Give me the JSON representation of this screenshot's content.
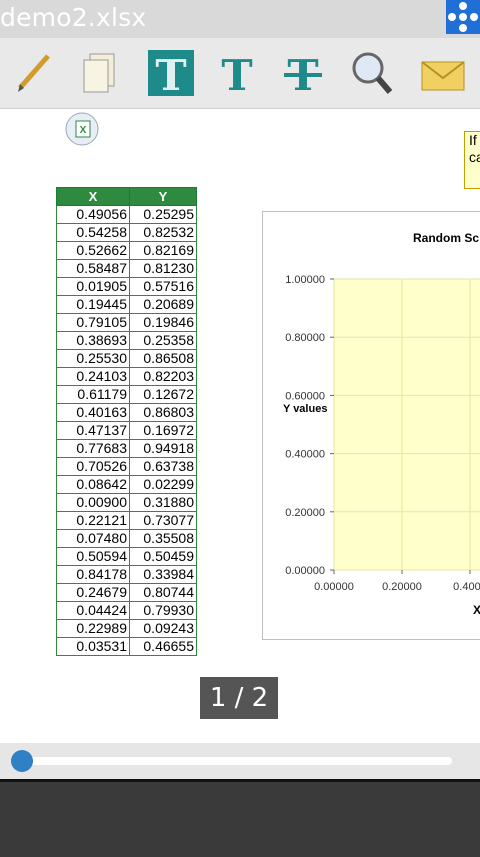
{
  "window": {
    "title": "demo2.xlsx"
  },
  "toolbar": {
    "buttons": [
      {
        "icon": "pencil-icon"
      },
      {
        "icon": "pages-icon"
      },
      {
        "icon": "text-bold-icon"
      },
      {
        "icon": "text-icon"
      },
      {
        "icon": "text-strikethrough-icon"
      },
      {
        "icon": "search-icon"
      },
      {
        "icon": "mail-icon"
      }
    ]
  },
  "sheet": {
    "columns": [
      "X",
      "Y"
    ],
    "rows": [
      [
        "0.49056",
        "0.25295"
      ],
      [
        "0.54258",
        "0.82532"
      ],
      [
        "0.52662",
        "0.82169"
      ],
      [
        "0.58487",
        "0.81230"
      ],
      [
        "0.01905",
        "0.57516"
      ],
      [
        "0.19445",
        "0.20689"
      ],
      [
        "0.79105",
        "0.19846"
      ],
      [
        "0.38693",
        "0.25358"
      ],
      [
        "0.25530",
        "0.86508"
      ],
      [
        "0.24103",
        "0.82203"
      ],
      [
        "0.61179",
        "0.12672"
      ],
      [
        "0.40163",
        "0.86803"
      ],
      [
        "0.47137",
        "0.16972"
      ],
      [
        "0.77683",
        "0.94918"
      ],
      [
        "0.70526",
        "0.63738"
      ],
      [
        "0.08642",
        "0.02299"
      ],
      [
        "0.00900",
        "0.31880"
      ],
      [
        "0.22121",
        "0.73077"
      ],
      [
        "0.07480",
        "0.35508"
      ],
      [
        "0.50594",
        "0.50459"
      ],
      [
        "0.84178",
        "0.33984"
      ],
      [
        "0.24679",
        "0.80744"
      ],
      [
        "0.04424",
        "0.79930"
      ],
      [
        "0.22989",
        "0.09243"
      ],
      [
        "0.03531",
        "0.46655"
      ]
    ],
    "note_text": "If ca"
  },
  "chart_data": {
    "type": "scatter",
    "title": "Random Sc",
    "xlabel": "X",
    "ylabel": "Y values",
    "x_ticks": [
      "0.00000",
      "0.20000",
      "0.4000"
    ],
    "y_ticks": [
      "0.00000",
      "0.20000",
      "0.40000",
      "0.60000",
      "0.80000",
      "1.00000"
    ],
    "xlim": [
      0,
      1
    ],
    "ylim": [
      0,
      1
    ],
    "plot_background": "#ffffcc",
    "grid": true
  },
  "pager": {
    "label": "1 / 2"
  },
  "slider": {
    "value": 0.0
  },
  "colors": {
    "header_green": "#2d8a3f",
    "accent_blue": "#2f80c5"
  }
}
